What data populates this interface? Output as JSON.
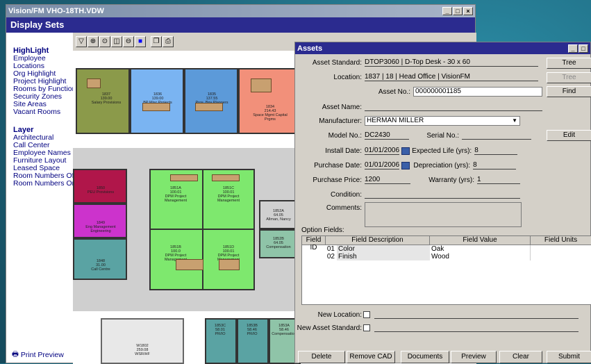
{
  "main_window": {
    "title": "Vision/FM VHO-18TH.VDW",
    "header": "Display Sets"
  },
  "sidebar": {
    "highlight_title": "HighLight",
    "highlight_items": [
      "Employee",
      "Locations",
      "Org Highlight",
      "Project Highlight",
      "Rooms by Function",
      "Security Zones",
      "Site Areas",
      "Vacant Rooms"
    ],
    "layer_title": "Layer",
    "layer_items": [
      "Architectural",
      "Call Center",
      "Employee Names",
      "Furniture Layout",
      "Leased Space",
      "Room Numbers Off",
      "Room Numbers On"
    ],
    "print_preview": "Print Preview"
  },
  "rooms": [
    {
      "num": "1837",
      "area": "139.00",
      "dept": "Salary Provisions"
    },
    {
      "num": "1836",
      "area": "139.00",
      "dept": "BP Misc Projects"
    },
    {
      "num": "1835",
      "area": "137.55",
      "dept": "Pros_Bnv Planners"
    },
    {
      "num": "1834",
      "area": "214.43",
      "dept": "Space Mgmt Capital Prgms"
    },
    {
      "num": "1851A",
      "area": "100.01",
      "dept": "DPM Project Management"
    },
    {
      "num": "1851C",
      "area": "100.01",
      "dept": "DPM Project Management"
    },
    {
      "num": "1851B",
      "area": "100.0",
      "dept": "DPM Project Management"
    },
    {
      "num": "1851D",
      "area": "100.01",
      "dept": "DPM Project Management"
    },
    {
      "num": "1852A",
      "area": "64.05",
      "dept": "Allman, Nancy"
    },
    {
      "num": "1852B",
      "area": "64.05",
      "dept": "Compensation"
    },
    {
      "num": "1850",
      "area": "",
      "dept": "PEU Provisions"
    },
    {
      "num": "1849",
      "area": "",
      "dept": "Eng Management Engineering"
    },
    {
      "num": "1848",
      "area": "31.00",
      "dept": "Call Centre"
    },
    {
      "num": "1853C",
      "area": "58.01",
      "dept": "PR/IO"
    },
    {
      "num": "1853B",
      "area": "58.46",
      "dept": "PR/IO"
    },
    {
      "num": "1853A",
      "area": "58.46",
      "dept": "Compensation"
    },
    {
      "num": "W1802",
      "area": "259.08",
      "dept": "WSR/HF"
    }
  ],
  "assets": {
    "title": "Assets",
    "asset_standard_label": "Asset Standard:",
    "asset_standard_value": "DTOP3060 | D-Top Desk - 30 x 60",
    "location_label": "Location:",
    "location_value": "1837 | 18 | Head Office | VisionFM",
    "asset_no_label": "Asset No.:",
    "asset_no_value": "000000001185",
    "asset_name_label": "Asset Name:",
    "asset_name_value": "",
    "manufacturer_label": "Manufacturer:",
    "manufacturer_value": "HERMAN MILLER",
    "model_no_label": "Model No.:",
    "model_no_value": "DC2430",
    "serial_no_label": "Serial No.:",
    "serial_no_value": "",
    "install_date_label": "Install Date:",
    "install_date_value": "01/01/2006",
    "expected_life_label": "Expected Life (yrs):",
    "expected_life_value": "8",
    "purchase_date_label": "Purchase Date:",
    "purchase_date_value": "01/01/2006",
    "depreciation_label": "Depreciation (yrs):",
    "depreciation_value": "8",
    "purchase_price_label": "Purchase Price:",
    "purchase_price_value": "1200",
    "warranty_label": "Warranty (yrs):",
    "warranty_value": "1",
    "condition_label": "Condition:",
    "comments_label": "Comments:",
    "option_fields_label": "Option Fields:",
    "grid_headers": [
      "Field ID",
      "Field Description",
      "Field Value",
      "Field Units"
    ],
    "grid_rows": [
      {
        "id": "01",
        "desc": "Color",
        "value": "Oak",
        "units": ""
      },
      {
        "id": "02",
        "desc": "Finish",
        "value": "Wood",
        "units": ""
      }
    ],
    "new_location_label": "New Location:",
    "new_asset_standard_label": "New Asset Standard:",
    "btn_tree1": "Tree",
    "btn_tree2": "Tree",
    "btn_find": "Find",
    "btn_edit": "Edit",
    "bottom_buttons": [
      "Delete",
      "Remove CAD",
      "Documents",
      "Preview",
      "Clear",
      "Submit"
    ]
  }
}
